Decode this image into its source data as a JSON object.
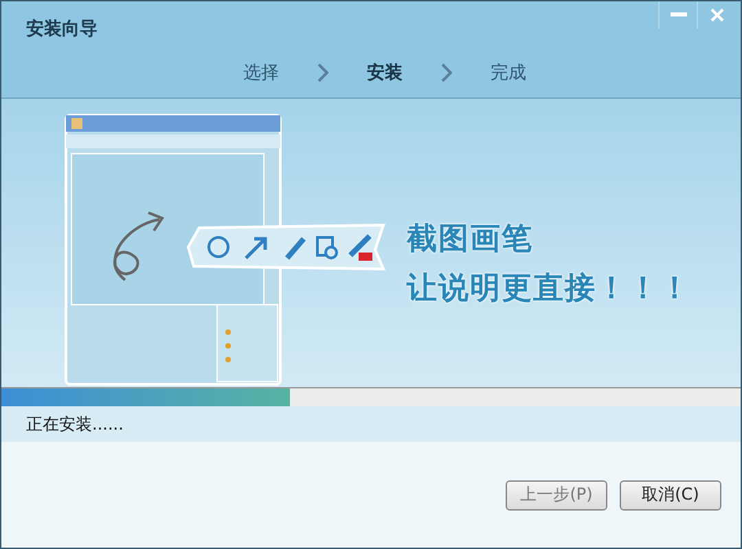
{
  "window": {
    "title": "安装向导"
  },
  "steps": [
    {
      "label": "选择",
      "selected": false
    },
    {
      "label": "安装",
      "selected": true
    },
    {
      "label": "完成",
      "selected": false
    }
  ],
  "banner": {
    "headline": "截图画笔",
    "tagline": "让说明更直接！！！"
  },
  "progress": {
    "level": 0.39
  },
  "status": "正在安装......",
  "buttons": [
    {
      "label": "上一步(P)",
      "disabled": true
    },
    {
      "label": "取消(C)",
      "disabled": false
    }
  ]
}
